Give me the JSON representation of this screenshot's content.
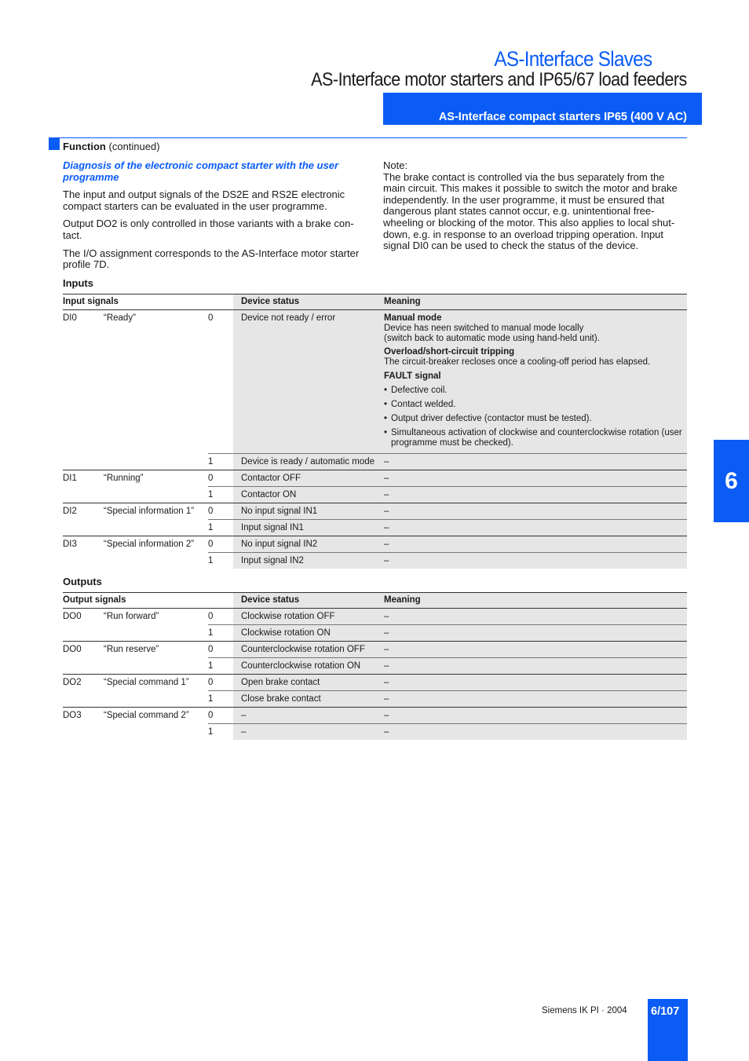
{
  "header": {
    "title": "AS-Interface Slaves",
    "subtitle": "AS-Interface motor starters and IP65/67 load feeders",
    "section_bar": "AS-Interface compact starters IP65 (400 V AC)"
  },
  "function": {
    "label": "Function",
    "suffix": "(continued)"
  },
  "left_col": {
    "heading": "Diagnosis of the electronic compact starter with the user programme",
    "paragraphs": [
      "The input and output signals of the DS2E and RS2E electronic compact starters can be evaluated in the user programme.",
      "Output DO2 is only controlled in those variants with a brake con-tact.",
      "The I/O assignment corresponds to the AS-Interface motor starter profile 7D."
    ]
  },
  "right_col": {
    "note_label": "Note:",
    "note_text": "The brake contact is controlled via the bus separately from the main circuit. This makes it possible to switch the motor and brake independently. In the user programme, it must be ensured that dangerous plant states cannot occur, e.g. unintentional free-wheeling or blocking of the motor. This also applies to local shut-down, e.g. in response to an overload tripping operation. Input signal DI0 can be used to check the status of the device."
  },
  "inputs": {
    "title": "Inputs",
    "headers": [
      "Input signals",
      "Device status",
      "Meaning"
    ],
    "di0": {
      "signal": "DI0",
      "name": "“Ready”",
      "row0": {
        "value": "0",
        "status": "Device not ready / error",
        "manual_head": "Manual mode",
        "manual_text1": "Device has neen switched to manual mode locally",
        "manual_text2": "(switch back to automatic mode using hand-held unit).",
        "overload_head": "Overload/short-circuit tripping",
        "overload_text": "The circuit-breaker recloses once a cooling-off period has elapsed.",
        "fault_head": "FAULT signal",
        "bullets": [
          "Defective coil.",
          "Contact welded.",
          "Output driver defective (contactor must be tested).",
          "Simultaneous activation of clockwise and counterclockwise rotation (user programme must be checked)."
        ]
      },
      "row1": {
        "value": "1",
        "status": "Device is ready / automatic mode",
        "meaning": "–"
      }
    },
    "rows": [
      {
        "signal": "DI1",
        "name": "“Running”",
        "value": "0",
        "status": "Contactor OFF",
        "meaning": "–"
      },
      {
        "signal": "",
        "name": "",
        "value": "1",
        "status": "Contactor ON",
        "meaning": "–"
      },
      {
        "signal": "DI2",
        "name": "“Special information 1”",
        "value": "0",
        "status": "No input signal IN1",
        "meaning": "–"
      },
      {
        "signal": "",
        "name": "",
        "value": "1",
        "status": "Input signal IN1",
        "meaning": "–"
      },
      {
        "signal": "DI3",
        "name": "“Special information 2”",
        "value": "0",
        "status": "No input signal IN2",
        "meaning": "–"
      },
      {
        "signal": "",
        "name": "",
        "value": "1",
        "status": "Input signal IN2",
        "meaning": "–"
      }
    ]
  },
  "outputs": {
    "title": "Outputs",
    "headers": [
      "Output signals",
      "Device status",
      "Meaning"
    ],
    "rows": [
      {
        "signal": "DO0",
        "name": "“Run forward”",
        "value": "0",
        "status": "Clockwise rotation OFF",
        "meaning": "–"
      },
      {
        "signal": "",
        "name": "",
        "value": "1",
        "status": "Clockwise rotation ON",
        "meaning": "–"
      },
      {
        "signal": "DO0",
        "name": "“Run reserve”",
        "value": "0",
        "status": "Counterclockwise rotation OFF",
        "meaning": "–"
      },
      {
        "signal": "",
        "name": "",
        "value": "1",
        "status": "Counterclockwise rotation ON",
        "meaning": "–"
      },
      {
        "signal": "DO2",
        "name": "“Special command 1”",
        "value": "0",
        "status": "Open brake contact",
        "meaning": "–"
      },
      {
        "signal": "",
        "name": "",
        "value": "1",
        "status": "Close brake contact",
        "meaning": "–"
      },
      {
        "signal": "DO3",
        "name": "“Special command 2”",
        "value": "0",
        "status": "–",
        "meaning": "–"
      },
      {
        "signal": "",
        "name": "",
        "value": "1",
        "status": "–",
        "meaning": "–"
      }
    ]
  },
  "side_tab": "6",
  "footer": {
    "publisher": "Siemens IK PI · 2004",
    "page": "6/107"
  },
  "colors": {
    "accent": "#0a5cf5",
    "table_shade": "#e6e6e6"
  }
}
